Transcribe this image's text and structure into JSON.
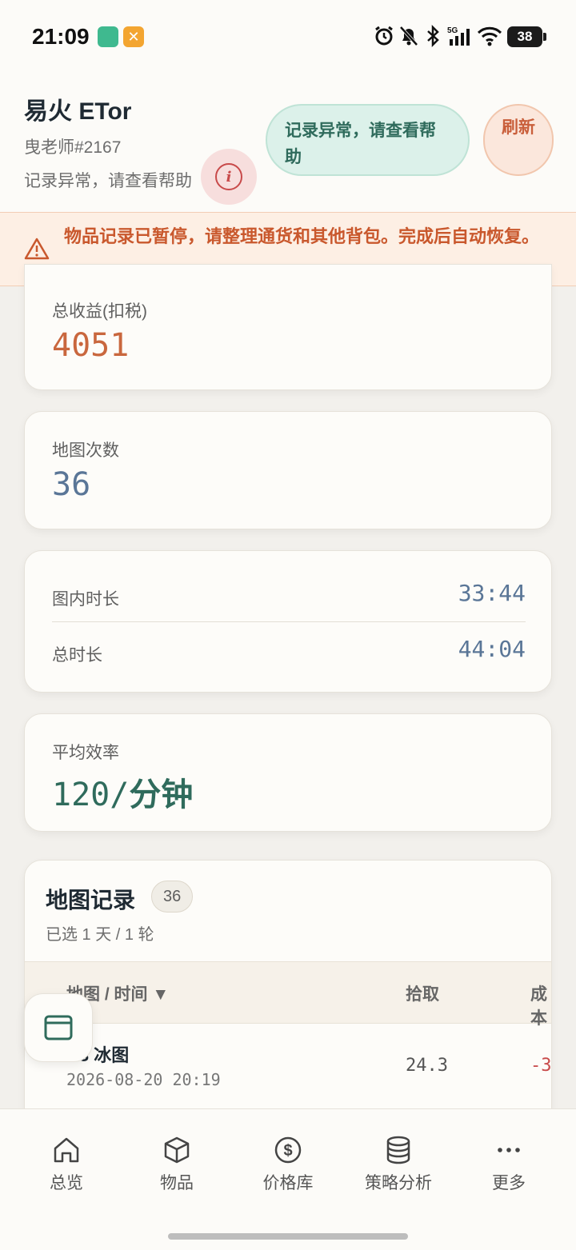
{
  "status_bar": {
    "time": "21:09",
    "battery": "38",
    "icons": [
      "alarm-icon",
      "bell-off-icon",
      "bluetooth-icon",
      "signal-5g-icon",
      "wifi-icon"
    ]
  },
  "header": {
    "title": "易火 ETor",
    "user": "曳老师#2167",
    "error_text": "记录异常，请查看帮助",
    "help_button": "记录异常，请查看帮助",
    "refresh_button": "刷新"
  },
  "warning": {
    "text": "物品记录已暂停，请整理通货和其他背包。完成后自动恢复。"
  },
  "stats": {
    "income_label": "总收益(扣税)",
    "income_value": "4051",
    "maps_label": "地图次数",
    "maps_value": "36",
    "in_map_label": "图内时长",
    "in_map_value": "33:44",
    "total_label": "总时长",
    "total_value": "44:04",
    "efficiency_label": "平均效率",
    "efficiency_value": "120/",
    "efficiency_unit": "分钟"
  },
  "records": {
    "title": "地图记录",
    "count": "36",
    "subtitle": "已选 1 天 / 1 轮",
    "columns": [
      "地图 / 时间 ▼",
      "拾取",
      "成本"
    ],
    "rows": [
      {
        "name": "U3 冰图",
        "time": "2026-08-20 20:19",
        "pickup": "24.3",
        "cost": "-3"
      }
    ]
  },
  "nav": {
    "items": [
      {
        "label": "总览",
        "icon": "home-icon"
      },
      {
        "label": "物品",
        "icon": "box-icon"
      },
      {
        "label": "价格库",
        "icon": "dollar-icon"
      },
      {
        "label": "策略分析",
        "icon": "database-icon"
      },
      {
        "label": "更多",
        "icon": "more-icon"
      }
    ]
  },
  "colors": {
    "accent_green": "#2f6b5c",
    "accent_orange": "#c9582d",
    "value_blue": "#5a7697",
    "income_orange": "#c9673e",
    "error_red": "#c84a4a"
  }
}
